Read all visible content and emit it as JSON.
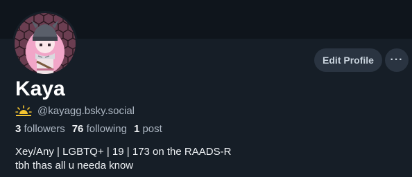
{
  "profile": {
    "display_name": "Kaya",
    "handle": "@kayagg.bsky.social",
    "handle_icon": "sun-emoji-icon",
    "avatar_icon": "avatar-image",
    "followers_count": "3",
    "followers_label": "followers",
    "following_count": "76",
    "following_label": "following",
    "posts_count": "1",
    "posts_label": "post",
    "bio_lines": [
      "Xey/Any | LGBTQ+ | 19 | 173 on the RAADS-R",
      "tbh thas all u needa know"
    ]
  },
  "actions": {
    "edit_label": "Edit Profile",
    "more_label": "···"
  },
  "colors": {
    "background": "#161e27",
    "banner": "#0f151c",
    "button_bg": "#2a3441",
    "avatar_hex": "#6d3f52"
  }
}
